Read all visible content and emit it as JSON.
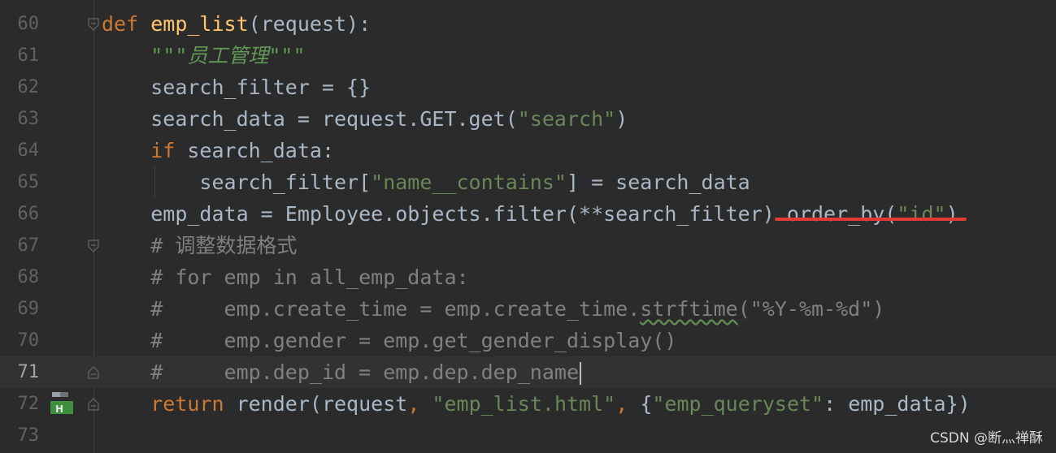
{
  "editor": {
    "lines": [
      {
        "num": "60"
      },
      {
        "num": "61"
      },
      {
        "num": "62"
      },
      {
        "num": "63"
      },
      {
        "num": "64"
      },
      {
        "num": "65"
      },
      {
        "num": "66"
      },
      {
        "num": "67"
      },
      {
        "num": "68"
      },
      {
        "num": "69"
      },
      {
        "num": "70"
      },
      {
        "num": "71"
      },
      {
        "num": "72"
      },
      {
        "num": "73"
      }
    ],
    "current_line": "71",
    "tokens": {
      "l60": {
        "def": "def",
        "name": "emp_list",
        "rest": "(request):"
      },
      "l61": {
        "doc": "\"\"\"员工管理\"\"\""
      },
      "l62": {
        "code": "search_filter = {}"
      },
      "l63": {
        "a": "search_data = request.GET.get(",
        "s": "\"search\"",
        "b": ")"
      },
      "l64": {
        "kw": "if",
        "rest": " search_data:"
      },
      "l65": {
        "a": "search_filter[",
        "s": "\"name__contains\"",
        "b": "] = search_data"
      },
      "l66": {
        "a": "emp_data = Employee.objects.filter(**search_filter)",
        "strike_a": ".order_by(",
        "strike_s": "\"id\"",
        "strike_b": ")"
      },
      "l67": {
        "cm": "# 调整数据格式"
      },
      "l68": {
        "cm": "# for emp in all_emp_data:"
      },
      "l69": {
        "cm_a": "#     emp.create_time = emp.create_time.",
        "cm_w": "strftime",
        "cm_b": "(\"%Y-%m-%d\")"
      },
      "l70": {
        "cm": "#     emp.gender = emp.get_gender_display()"
      },
      "l71": {
        "cm": "#     emp.dep_id = emp.dep.dep_name"
      },
      "l72": {
        "kw": "return",
        "a": " render(request",
        "c1": ",",
        "s1": " \"emp_list.html\"",
        "c2": ",",
        "b": " {",
        "s2": "\"emp_queryset\"",
        "c": ": emp_data})"
      }
    }
  },
  "watermark": "CSDN @断灬禅酥",
  "colors": {
    "background": "#2b2b2b",
    "keyword": "#cc7832",
    "function": "#ffc66d",
    "string": "#6a8759",
    "comment": "#808080",
    "strike": "#e53935"
  }
}
